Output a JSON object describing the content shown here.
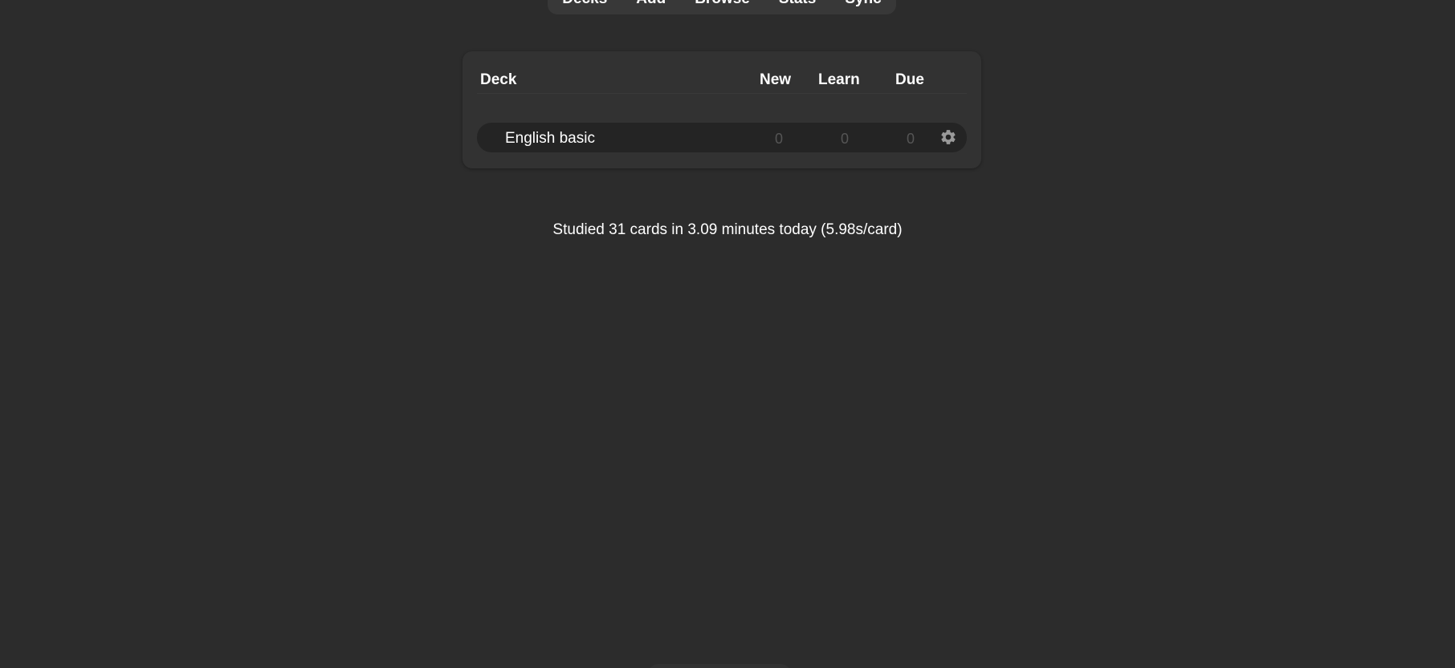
{
  "toolbar": {
    "items": [
      {
        "label": "Decks"
      },
      {
        "label": "Add"
      },
      {
        "label": "Browse"
      },
      {
        "label": "Stats"
      },
      {
        "label": "Sync"
      }
    ]
  },
  "deck_table": {
    "headers": {
      "deck": "Deck",
      "new": "New",
      "learn": "Learn",
      "due": "Due"
    },
    "rows": [
      {
        "name": "English basic",
        "new": "0",
        "learn": "0",
        "due": "0",
        "options_icon": "gear-icon"
      }
    ]
  },
  "studied_today": "Studied 31 cards in 3.09 minutes today (5.98s/card)",
  "colors": {
    "background": "#2c2c2c",
    "card": "#323232",
    "row": "#242424",
    "text": "#ffffff",
    "muted_count": "#555555"
  }
}
